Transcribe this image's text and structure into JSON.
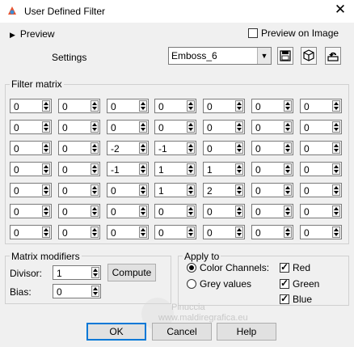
{
  "window": {
    "title": "User Defined Filter",
    "close_glyph": "✕"
  },
  "preview": {
    "label": "Preview",
    "on_image_label": "Preview on Image",
    "on_image_checked": false
  },
  "settings": {
    "label": "Settings",
    "preset": "Emboss_6"
  },
  "matrix": {
    "title": "Filter matrix",
    "values": [
      [
        "0",
        "0",
        "0",
        "0",
        "0",
        "0",
        "0"
      ],
      [
        "0",
        "0",
        "0",
        "0",
        "0",
        "0",
        "0"
      ],
      [
        "0",
        "0",
        "-2",
        "-1",
        "0",
        "0",
        "0"
      ],
      [
        "0",
        "0",
        "-1",
        "1",
        "1",
        "0",
        "0"
      ],
      [
        "0",
        "0",
        "0",
        "1",
        "2",
        "0",
        "0"
      ],
      [
        "0",
        "0",
        "0",
        "0",
        "0",
        "0",
        "0"
      ],
      [
        "0",
        "0",
        "0",
        "0",
        "0",
        "0",
        "0"
      ]
    ]
  },
  "modifiers": {
    "title": "Matrix modifiers",
    "divisor_label": "Divisor:",
    "divisor": "1",
    "bias_label": "Bias:",
    "bias": "0",
    "compute_label": "Compute"
  },
  "apply_to": {
    "title": "Apply to",
    "color_channels_label": "Color Channels:",
    "grey_values_label": "Grey values",
    "selected": "color_channels",
    "red_label": "Red",
    "green_label": "Green",
    "blue_label": "Blue",
    "red": true,
    "green": true,
    "blue": true
  },
  "watermark": {
    "line1": "Pinuccia",
    "line2": "www.maldiregrafica.eu"
  },
  "buttons": {
    "ok": "OK",
    "cancel": "Cancel",
    "help": "Help"
  }
}
